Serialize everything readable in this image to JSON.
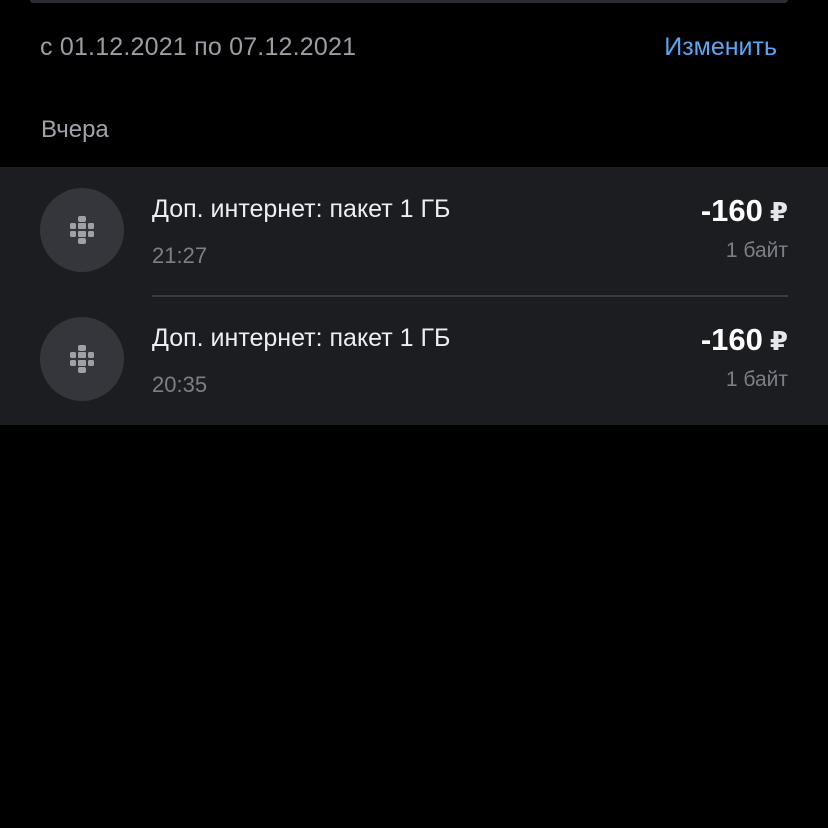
{
  "period": {
    "text": "с 01.12.2021 по 07.12.2021",
    "change_label": "Изменить"
  },
  "section": {
    "title": "Вчера"
  },
  "items": [
    {
      "icon": "globe-icon",
      "title": "Доп. интернет: пакет 1 ГБ",
      "time": "21:27",
      "amount": "-160",
      "currency": "₽",
      "sub": "1 байт"
    },
    {
      "icon": "globe-icon",
      "title": "Доп. интернет: пакет 1 ГБ",
      "time": "20:35",
      "amount": "-160",
      "currency": "₽",
      "sub": "1 байт"
    }
  ],
  "colors": {
    "background": "#000000",
    "card": "#1c1d21",
    "accent": "#5aa6f2",
    "icon_bg": "#34363c"
  }
}
